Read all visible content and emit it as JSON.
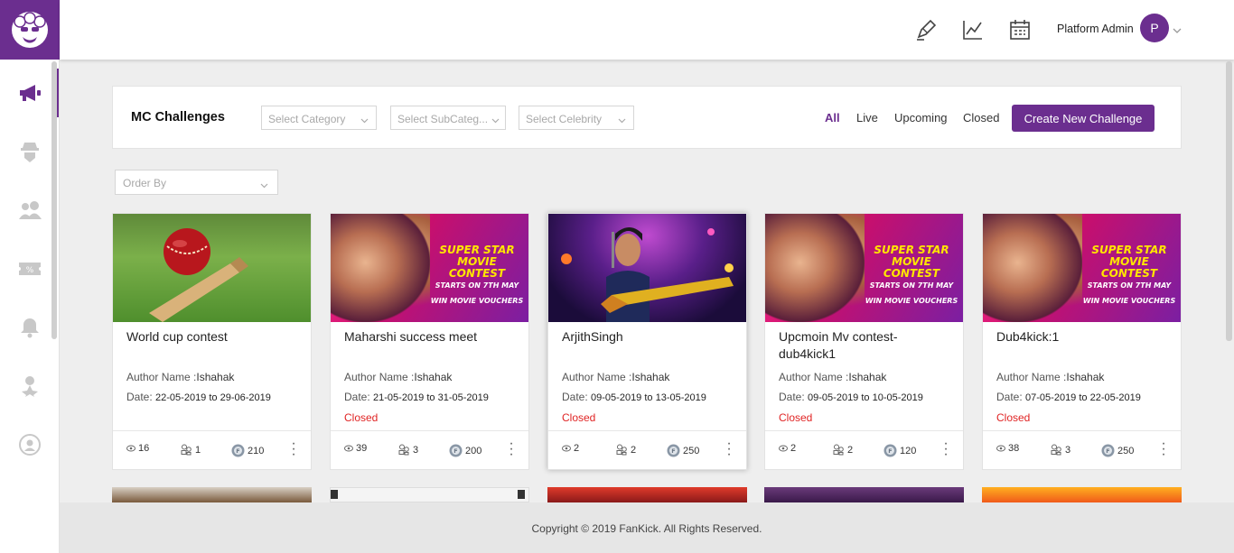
{
  "header": {
    "user_name": "Platform Admin",
    "avatar_initial": "P",
    "icons": [
      "edit-icon",
      "analytics-icon",
      "calendar-icon"
    ]
  },
  "sidebar": {
    "items": [
      "megaphone-icon",
      "detective-icon",
      "users-icon",
      "coupon-icon",
      "bell-icon",
      "star-user-icon",
      "support-icon"
    ]
  },
  "filters": {
    "title": "MC Challenges",
    "category_placeholder": "Select Category",
    "subcategory_placeholder": "Select SubCateg...",
    "celebrity_placeholder": "Select Celebrity",
    "order_placeholder": "Order By",
    "tabs": [
      "All",
      "Live",
      "Upcoming",
      "Closed"
    ],
    "active_tab": "All",
    "create_button": "Create New Challenge"
  },
  "poster": {
    "line1": "SUPER STAR",
    "line2": "MOVIE CONTEST",
    "line3": "STARTS ON 7TH MAY",
    "line4": "WIN MOVIE VOUCHERS"
  },
  "cards": [
    {
      "title": "World cup contest",
      "author_label": "Author Name :",
      "author": "Ishahak",
      "date_label": "Date:",
      "date": "22-05-2019 to 29-06-2019",
      "status": "",
      "views": "16",
      "participants": "1",
      "coins": "210",
      "image": "cricket"
    },
    {
      "title": "Maharshi success meet",
      "author_label": "Author Name :",
      "author": "Ishahak",
      "date_label": "Date:",
      "date": "21-05-2019 to 31-05-2019",
      "status": "Closed",
      "views": "39",
      "participants": "3",
      "coins": "200",
      "image": "poster"
    },
    {
      "title": "ArjithSingh",
      "author_label": "Author Name :",
      "author": "Ishahak",
      "date_label": "Date:",
      "date": "09-05-2019 to 13-05-2019",
      "status": "Closed",
      "views": "2",
      "participants": "2",
      "coins": "250",
      "image": "concert"
    },
    {
      "title": "Upcmoin Mv contest-dub4kick1",
      "author_label": "Author Name :",
      "author": "Ishahak",
      "date_label": "Date:",
      "date": "09-05-2019 to 10-05-2019",
      "status": "Closed",
      "views": "2",
      "participants": "2",
      "coins": "120",
      "image": "poster"
    },
    {
      "title": "Dub4kick:1",
      "author_label": "Author Name :",
      "author": "Ishahak",
      "date_label": "Date:",
      "date": "07-05-2019 to 22-05-2019",
      "status": "Closed",
      "views": "38",
      "participants": "3",
      "coins": "250",
      "image": "poster"
    }
  ],
  "colors": {
    "brand": "#6b2e8f",
    "closed": "#e02424"
  },
  "footer": {
    "copyright": "Copyright © 2019 FanKick. All Rights Reserved."
  }
}
